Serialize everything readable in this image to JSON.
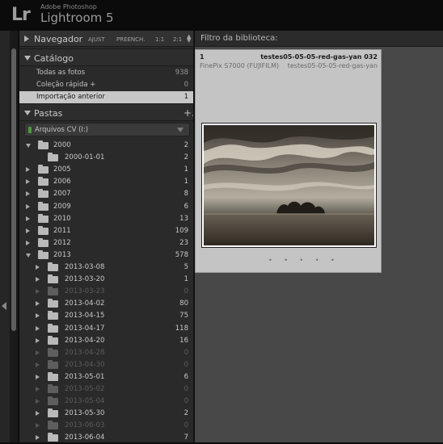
{
  "app": {
    "logo": "Lr",
    "vendor": "Adobe Photoshop",
    "name": "Lightroom 5"
  },
  "navigator": {
    "title": "Navegador",
    "zoom_options": [
      "AJUST",
      "PREENCH.",
      "1:1",
      "2:1"
    ]
  },
  "catalog": {
    "title": "Catálogo",
    "items": [
      {
        "label": "Todas as fotos",
        "count": "938",
        "selected": false
      },
      {
        "label": "Coleção rápida  +",
        "count": "0",
        "selected": false
      },
      {
        "label": "Importação anterior",
        "count": "1",
        "selected": true
      }
    ]
  },
  "folders": {
    "title": "Pastas",
    "add_label": "+.",
    "volume": "Arquivos CV (I:)",
    "items": [
      {
        "label": "2000",
        "count": "2",
        "level": 0,
        "state": "expanded",
        "dim": false
      },
      {
        "label": "2000-01-01",
        "count": "2",
        "level": 1,
        "state": "none",
        "dim": false
      },
      {
        "label": "2005",
        "count": "1",
        "level": 0,
        "state": "collapsed",
        "dim": false
      },
      {
        "label": "2006",
        "count": "1",
        "level": 0,
        "state": "collapsed",
        "dim": false
      },
      {
        "label": "2007",
        "count": "8",
        "level": 0,
        "state": "collapsed",
        "dim": false
      },
      {
        "label": "2009",
        "count": "6",
        "level": 0,
        "state": "collapsed",
        "dim": false
      },
      {
        "label": "2010",
        "count": "13",
        "level": 0,
        "state": "collapsed",
        "dim": false
      },
      {
        "label": "2011",
        "count": "109",
        "level": 0,
        "state": "collapsed",
        "dim": false
      },
      {
        "label": "2012",
        "count": "23",
        "level": 0,
        "state": "collapsed",
        "dim": false
      },
      {
        "label": "2013",
        "count": "578",
        "level": 0,
        "state": "expanded",
        "dim": false
      },
      {
        "label": "2013-03-08",
        "count": "5",
        "level": 1,
        "state": "collapsed",
        "dim": false
      },
      {
        "label": "2013-03-20",
        "count": "1",
        "level": 1,
        "state": "collapsed",
        "dim": false
      },
      {
        "label": "2013-03-23",
        "count": "0",
        "level": 1,
        "state": "collapsed",
        "dim": true
      },
      {
        "label": "2013-04-02",
        "count": "80",
        "level": 1,
        "state": "collapsed",
        "dim": false
      },
      {
        "label": "2013-04-15",
        "count": "75",
        "level": 1,
        "state": "collapsed",
        "dim": false
      },
      {
        "label": "2013-04-17",
        "count": "118",
        "level": 1,
        "state": "collapsed",
        "dim": false
      },
      {
        "label": "2013-04-20",
        "count": "16",
        "level": 1,
        "state": "collapsed",
        "dim": false
      },
      {
        "label": "2013-04-28",
        "count": "0",
        "level": 1,
        "state": "collapsed",
        "dim": true
      },
      {
        "label": "2013-04-30",
        "count": "0",
        "level": 1,
        "state": "collapsed",
        "dim": true
      },
      {
        "label": "2013-05-01",
        "count": "6",
        "level": 1,
        "state": "collapsed",
        "dim": false
      },
      {
        "label": "2013-05-02",
        "count": "0",
        "level": 1,
        "state": "collapsed",
        "dim": true
      },
      {
        "label": "2013-05-04",
        "count": "0",
        "level": 1,
        "state": "collapsed",
        "dim": true
      },
      {
        "label": "2013-05-30",
        "count": "2",
        "level": 1,
        "state": "collapsed",
        "dim": false
      },
      {
        "label": "2013-06-03",
        "count": "0",
        "level": 1,
        "state": "collapsed",
        "dim": true
      },
      {
        "label": "2013-06-04",
        "count": "7",
        "level": 1,
        "state": "collapsed",
        "dim": false
      }
    ]
  },
  "library": {
    "filter_label": "Filtro da biblioteca:",
    "cell": {
      "index": "1",
      "filename": "testes05-05-05-red-gas-yan 032",
      "camera": "FinePix S7000 (FUJIFILM)",
      "filename2": "testes05-05-05-red-gas-yan",
      "dots": "• • • • •"
    }
  },
  "colors": {
    "selected_row": "#c7c7c7",
    "panel": "#2a2a2a",
    "grid_bg": "#484848",
    "cell_bg": "#c4c4c4"
  }
}
